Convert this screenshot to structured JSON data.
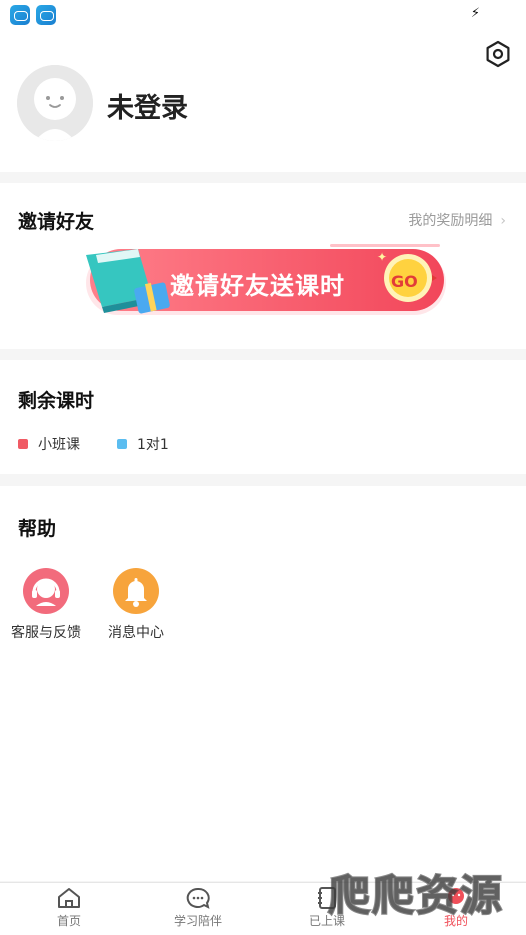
{
  "status_bar": {
    "notification_icons": [
      "app-notification-icon",
      "app-notification-icon"
    ],
    "charging_icon": "⚡"
  },
  "profile": {
    "username": "未登录",
    "settings_icon": "settings-hexagon-icon",
    "avatar_icon": "default-avatar-icon"
  },
  "invite": {
    "title": "邀请好友",
    "reward_detail_link": "我的奖励明细",
    "chevron": "›",
    "banner_text": "邀请好友送课时",
    "banner_go": "GO"
  },
  "remaining_hours": {
    "title": "剩余课时",
    "legend": [
      {
        "label": "小班课",
        "color": "#f05a64"
      },
      {
        "label": "1对1",
        "color": "#5bbdf0"
      }
    ]
  },
  "help": {
    "title": "帮助",
    "items": [
      {
        "label": "客服与反馈",
        "icon": "customer-service-icon",
        "color": "#f26b7c"
      },
      {
        "label": "消息中心",
        "icon": "bell-icon",
        "color": "#f7a43c"
      }
    ]
  },
  "tabbar": {
    "tabs": [
      {
        "label": "首页",
        "icon": "home-icon",
        "active": false
      },
      {
        "label": "学习陪伴",
        "icon": "chat-bubble-icon",
        "active": false
      },
      {
        "label": "已上课",
        "icon": "notebook-icon",
        "active": false
      },
      {
        "label": "我的",
        "icon": "profile-icon",
        "active": true
      }
    ],
    "active_color": "#f0505a"
  },
  "watermark": {
    "text": "爬爬资源"
  }
}
